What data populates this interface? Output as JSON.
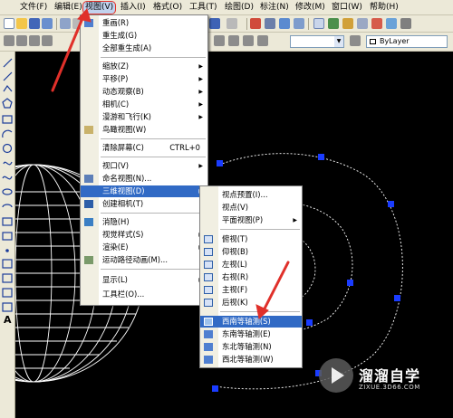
{
  "menubar": {
    "items": [
      {
        "label": "文件(F)"
      },
      {
        "label": "编辑(E)"
      },
      {
        "label": "视图(V)"
      },
      {
        "label": "插入(I)"
      },
      {
        "label": "格式(O)"
      },
      {
        "label": "工具(T)"
      },
      {
        "label": "绘图(D)"
      },
      {
        "label": "标注(N)"
      },
      {
        "label": "修改(M)"
      },
      {
        "label": "窗口(W)"
      },
      {
        "label": "帮助(H)"
      }
    ]
  },
  "toolbar": {
    "layer_combo": "ByLayer"
  },
  "view_menu": {
    "items": [
      {
        "label": "重画(R)"
      },
      {
        "label": "重生成(G)"
      },
      {
        "label": "全部重生成(A)"
      },
      {
        "label": "缩放(Z)"
      },
      {
        "label": "平移(P)"
      },
      {
        "label": "动态观察(B)"
      },
      {
        "label": "相机(C)"
      },
      {
        "label": "漫游和飞行(K)"
      },
      {
        "label": "鸟瞰视图(W)"
      },
      {
        "label": "清除屏幕(C)",
        "shortcut": "CTRL+0"
      },
      {
        "label": "视口(V)"
      },
      {
        "label": "命名视图(N)..."
      },
      {
        "label": "三维视图(D)"
      },
      {
        "label": "创建相机(T)"
      },
      {
        "label": "消隐(H)"
      },
      {
        "label": "视觉样式(S)"
      },
      {
        "label": "渲染(E)"
      },
      {
        "label": "运动路径动画(M)..."
      },
      {
        "label": "显示(L)"
      },
      {
        "label": "工具栏(O)..."
      }
    ]
  },
  "views3d_menu": {
    "items": [
      {
        "label": "视点预置(I)..."
      },
      {
        "label": "视点(V)"
      },
      {
        "label": "平面视图(P)"
      },
      {
        "label": "俯视(T)"
      },
      {
        "label": "仰视(B)"
      },
      {
        "label": "左视(L)"
      },
      {
        "label": "右视(R)"
      },
      {
        "label": "主视(F)"
      },
      {
        "label": "后视(K)"
      },
      {
        "label": "西南等轴测(S)"
      },
      {
        "label": "东南等轴测(E)"
      },
      {
        "label": "东北等轴测(N)"
      },
      {
        "label": "西北等轴测(W)"
      }
    ]
  },
  "watermark": {
    "title": "溜溜自学",
    "url": "ZIXUE.3D66.COM"
  },
  "colors": {
    "highlight": "#316ac5",
    "annotation": "#e0302a",
    "grip": "#1a3cff"
  }
}
